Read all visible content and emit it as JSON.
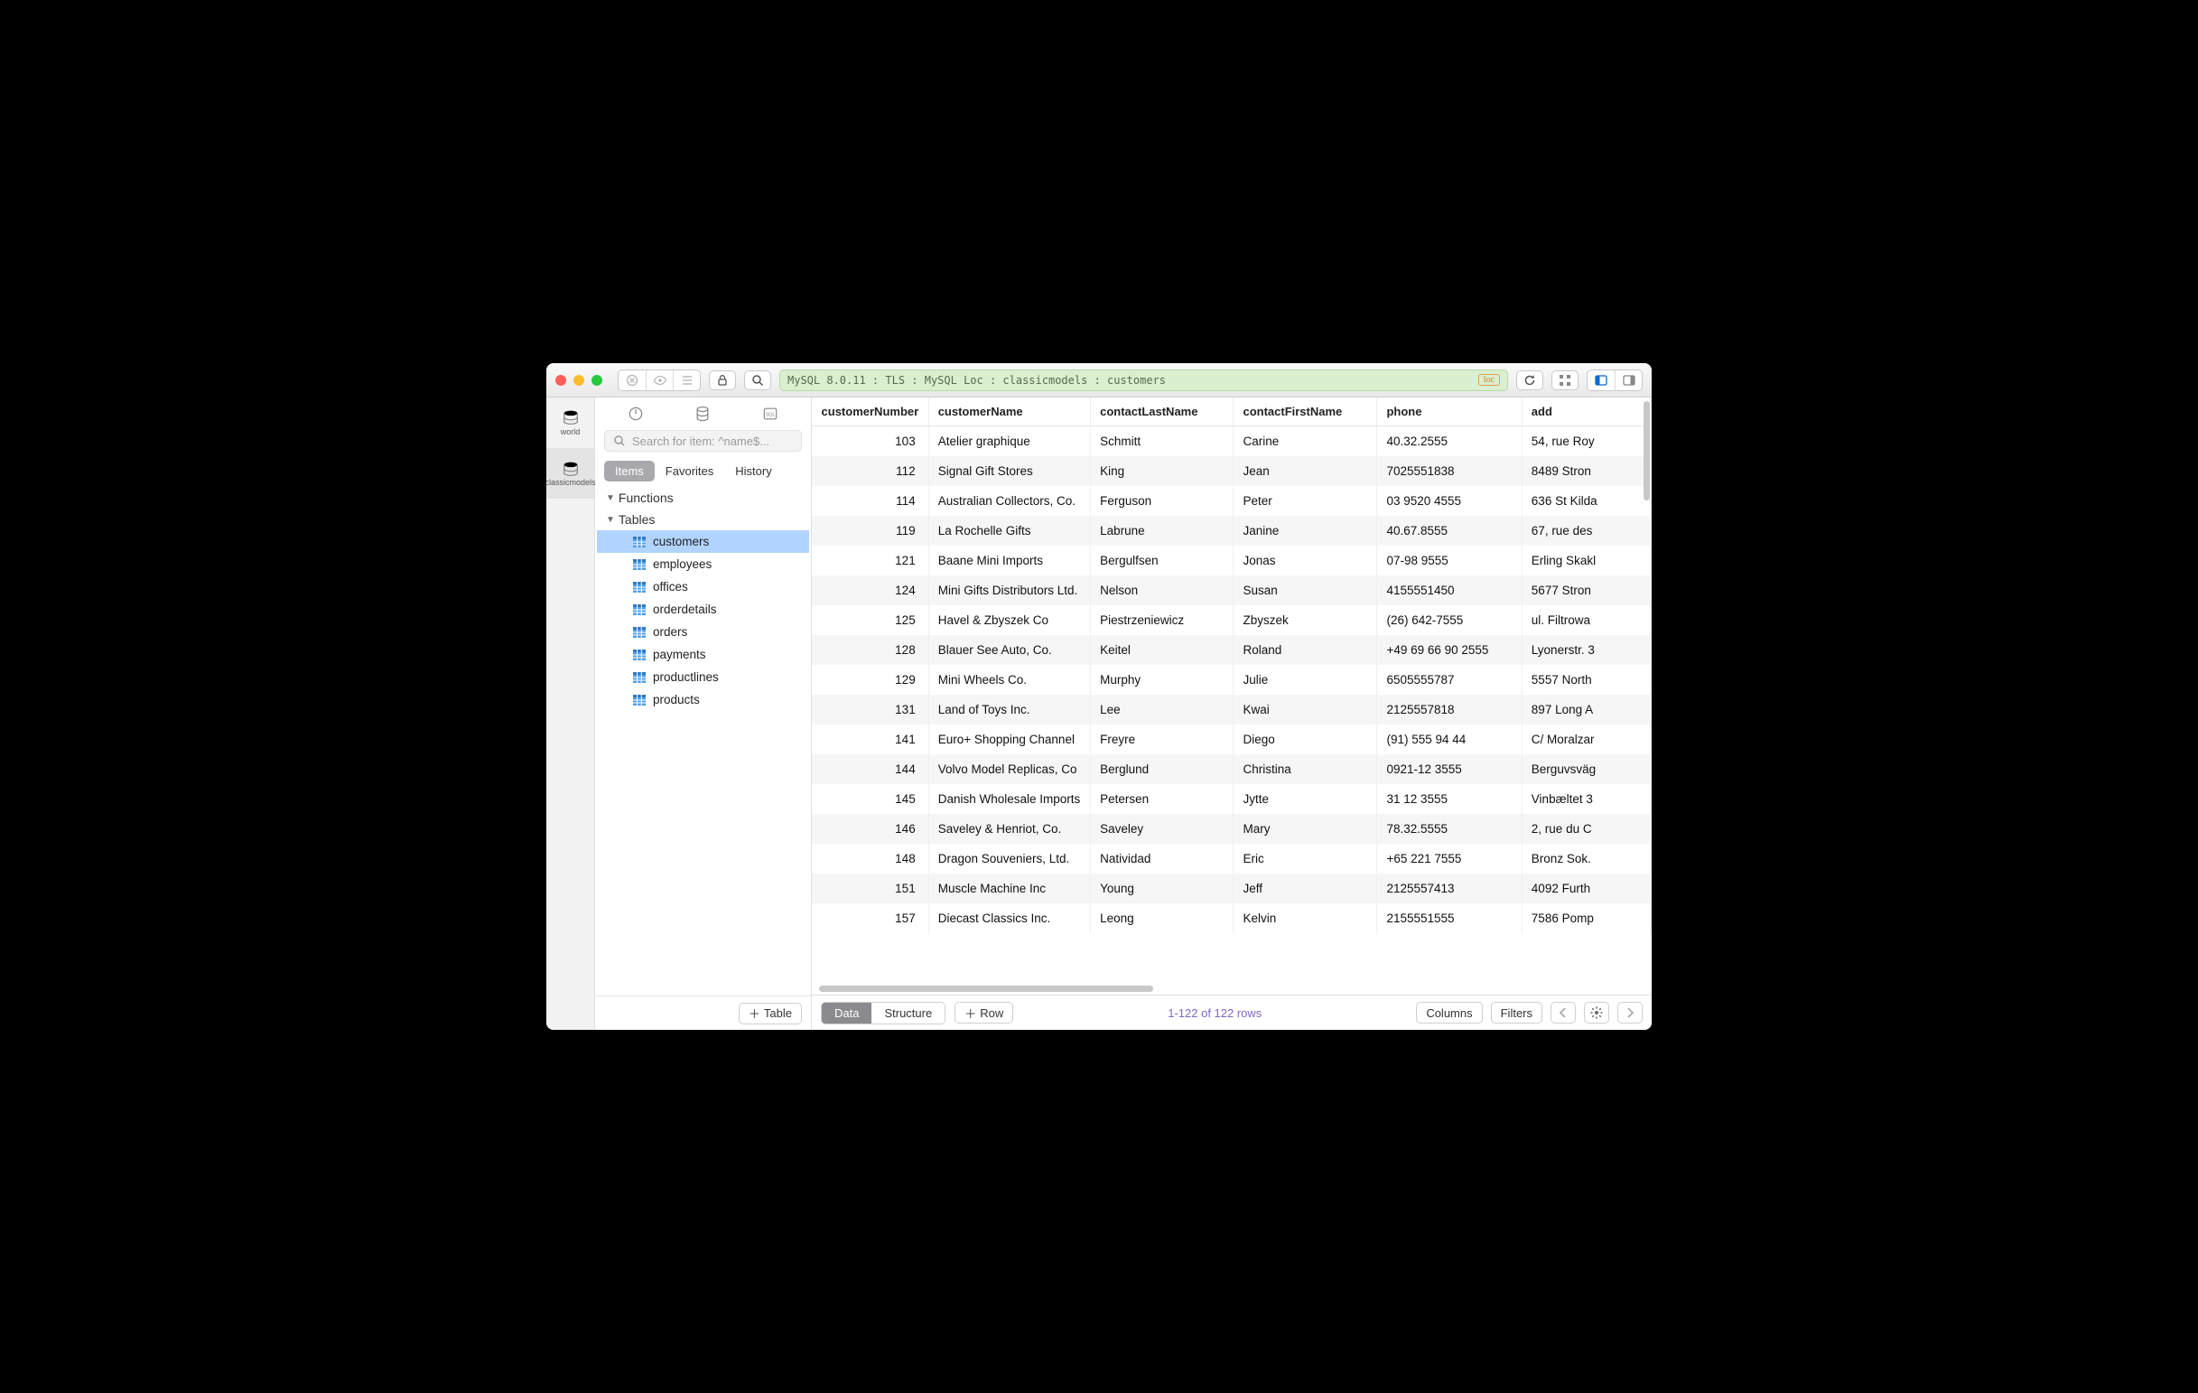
{
  "title_bar": {
    "breadcrumb": "MySQL 8.0.11 : TLS : MySQL Loc : classicmodels : customers",
    "loc_badge": "loc"
  },
  "rail": {
    "items": [
      {
        "label": "world"
      },
      {
        "label": "classicmodels"
      }
    ]
  },
  "sidebar": {
    "search_placeholder": "Search for item: ^name$...",
    "segments": {
      "items": "Items",
      "favorites": "Favorites",
      "history": "History"
    },
    "functions_header": "Functions",
    "tables_header": "Tables",
    "tables": [
      "customers",
      "employees",
      "offices",
      "orderdetails",
      "orders",
      "payments",
      "productlines",
      "products"
    ],
    "selected_table": "customers",
    "add_table_label": "Table"
  },
  "grid": {
    "columns": [
      "customerNumber",
      "customerName",
      "contactLastName",
      "contactFirstName",
      "phone",
      "add"
    ],
    "rows": [
      {
        "n": 103,
        "name": "Atelier graphique",
        "last": "Schmitt",
        "first": "Carine",
        "phone": "40.32.2555",
        "addr": "54, rue Roy"
      },
      {
        "n": 112,
        "name": "Signal Gift Stores",
        "last": "King",
        "first": "Jean",
        "phone": "7025551838",
        "addr": "8489 Stron"
      },
      {
        "n": 114,
        "name": "Australian Collectors, Co.",
        "last": "Ferguson",
        "first": "Peter",
        "phone": "03 9520 4555",
        "addr": "636 St Kilda"
      },
      {
        "n": 119,
        "name": "La Rochelle Gifts",
        "last": "Labrune",
        "first": "Janine",
        "phone": "40.67.8555",
        "addr": "67, rue des"
      },
      {
        "n": 121,
        "name": "Baane Mini Imports",
        "last": "Bergulfsen",
        "first": "Jonas",
        "phone": "07-98 9555",
        "addr": "Erling Skakl"
      },
      {
        "n": 124,
        "name": "Mini Gifts Distributors Ltd.",
        "last": "Nelson",
        "first": "Susan",
        "phone": "4155551450",
        "addr": "5677 Stron"
      },
      {
        "n": 125,
        "name": "Havel & Zbyszek Co",
        "last": "Piestrzeniewicz",
        "first": "Zbyszek",
        "phone": "(26) 642-7555",
        "addr": "ul. Filtrowa"
      },
      {
        "n": 128,
        "name": "Blauer See Auto, Co.",
        "last": "Keitel",
        "first": "Roland",
        "phone": "+49 69 66 90 2555",
        "addr": "Lyonerstr. 3"
      },
      {
        "n": 129,
        "name": "Mini Wheels Co.",
        "last": "Murphy",
        "first": "Julie",
        "phone": "6505555787",
        "addr": "5557 North"
      },
      {
        "n": 131,
        "name": "Land of Toys Inc.",
        "last": "Lee",
        "first": "Kwai",
        "phone": "2125557818",
        "addr": "897 Long A"
      },
      {
        "n": 141,
        "name": "Euro+ Shopping Channel",
        "last": "Freyre",
        "first": "Diego",
        "phone": "(91) 555 94 44",
        "addr": "C/ Moralzar"
      },
      {
        "n": 144,
        "name": "Volvo Model Replicas, Co",
        "last": "Berglund",
        "first": "Christina",
        "phone": "0921-12 3555",
        "addr": "Berguvsväg"
      },
      {
        "n": 145,
        "name": "Danish Wholesale Imports",
        "last": "Petersen",
        "first": "Jytte",
        "phone": "31 12 3555",
        "addr": "Vinbæltet 3"
      },
      {
        "n": 146,
        "name": "Saveley & Henriot, Co.",
        "last": "Saveley",
        "first": "Mary",
        "phone": "78.32.5555",
        "addr": "2, rue du C"
      },
      {
        "n": 148,
        "name": "Dragon Souveniers, Ltd.",
        "last": "Natividad",
        "first": "Eric",
        "phone": "+65 221 7555",
        "addr": "Bronz Sok."
      },
      {
        "n": 151,
        "name": "Muscle Machine Inc",
        "last": "Young",
        "first": "Jeff",
        "phone": "2125557413",
        "addr": "4092 Furth"
      },
      {
        "n": 157,
        "name": "Diecast Classics Inc.",
        "last": "Leong",
        "first": "Kelvin",
        "phone": "2155551555",
        "addr": "7586 Pomp"
      }
    ]
  },
  "footer": {
    "data_label": "Data",
    "structure_label": "Structure",
    "add_row_label": "Row",
    "status": "1-122 of 122 rows",
    "columns_label": "Columns",
    "filters_label": "Filters"
  }
}
